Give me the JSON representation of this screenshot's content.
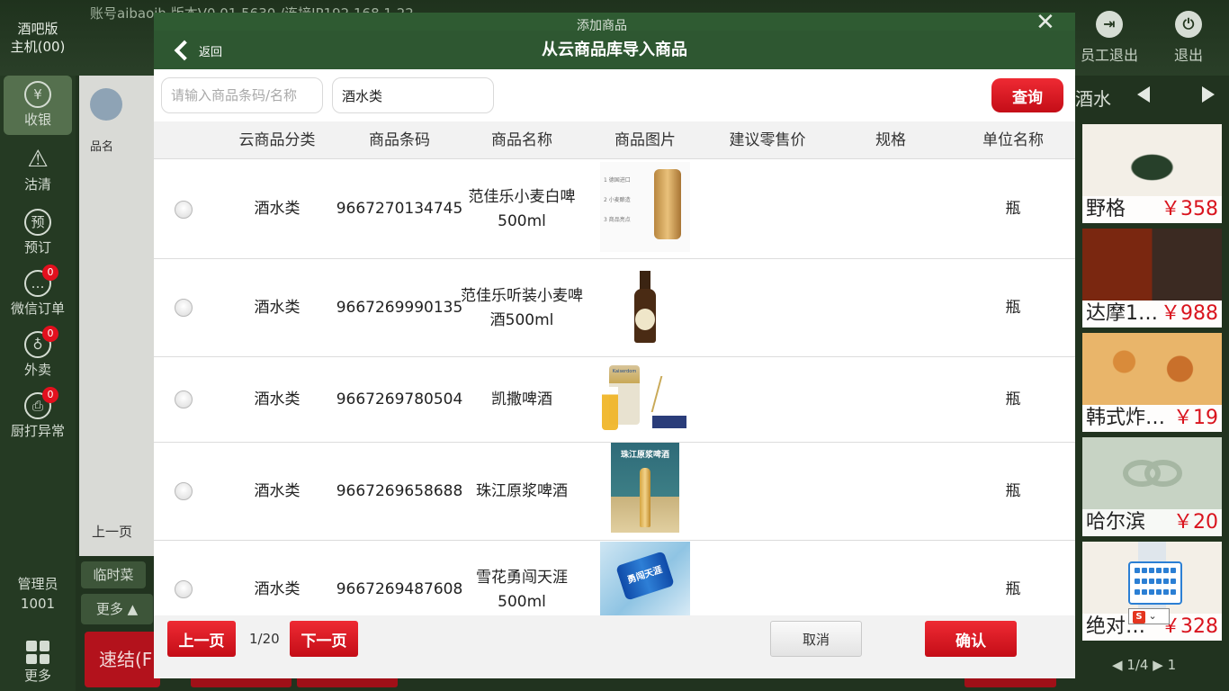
{
  "background": {
    "account_line": "账号aibaojh 版本V0.01.5630 /连接IP192.168.1.22",
    "brand_line1": "酒吧版",
    "brand_line2": "主机(00)",
    "sidebar": [
      {
        "label": "收银",
        "icon": "¥",
        "badge": null
      },
      {
        "label": "沽清",
        "icon": "⚠",
        "badge": null
      },
      {
        "label": "预订",
        "icon": "预",
        "badge": null
      },
      {
        "label": "微信订单",
        "icon": "…",
        "badge": "0"
      },
      {
        "label": "外卖",
        "icon": "♁",
        "badge": "0"
      },
      {
        "label": "厨打异常",
        "icon": "⎙",
        "badge": "0"
      }
    ],
    "user_role": "管理员",
    "user_id": "1001",
    "more_label": "更多",
    "order_name_header": "品名",
    "order_prev": "上一页",
    "temp_dish": "临时菜",
    "more_toggle": "更多",
    "quick_checkout": "速结(F",
    "staff_logout": "员工退出",
    "logout": "退出",
    "category_label": "酒水",
    "products": [
      {
        "name": "野格",
        "price": "￥358"
      },
      {
        "name": "达摩1…",
        "price": "￥988"
      },
      {
        "name": "韩式炸…",
        "price": "￥19"
      },
      {
        "name": "哈尔滨",
        "price": "￥20"
      },
      {
        "name": "绝对…",
        "price": "￥328"
      }
    ],
    "product_pager": "1/4",
    "product_pager_suffix": "1"
  },
  "modal": {
    "behind_title": "添加商品",
    "back_label": "返回",
    "title": "从云商品库导入商品",
    "search": {
      "placeholder": "请输入商品条码/名称",
      "category_value": "酒水类",
      "query_label": "查询"
    },
    "columns": [
      "云商品分类",
      "商品条码",
      "商品名称",
      "商品图片",
      "建议零售价",
      "规格",
      "单位名称"
    ],
    "rows": [
      {
        "category": "酒水类",
        "barcode": "9667270134745",
        "name": "范佳乐小麦白啤500ml",
        "price": "",
        "spec": "",
        "unit": "瓶"
      },
      {
        "category": "酒水类",
        "barcode": "9667269990135",
        "name": "范佳乐听装小麦啤酒500ml",
        "price": "",
        "spec": "",
        "unit": "瓶"
      },
      {
        "category": "酒水类",
        "barcode": "9667269780504",
        "name": "凯撒啤酒",
        "price": "",
        "spec": "",
        "unit": "瓶"
      },
      {
        "category": "酒水类",
        "barcode": "9667269658688",
        "name": "珠江原浆啤酒",
        "price": "",
        "spec": "",
        "unit": "瓶"
      },
      {
        "category": "酒水类",
        "barcode": "9667269487608",
        "name": "雪花勇闯天涯500ml",
        "price": "",
        "spec": "",
        "unit": "瓶"
      }
    ],
    "image_texts": {
      "img1_lines": [
        "1 德国进口",
        "2 小麦酿造",
        "3 商品亮点"
      ],
      "img4_title": "珠江原浆啤酒",
      "img5_text": "勇闯天涯",
      "img3_text": "Kaiserdom"
    },
    "footer": {
      "prev_label": "上一页",
      "page_indicator": "1/20",
      "next_label": "下一页",
      "cancel_label": "取消",
      "confirm_label": "确认"
    }
  },
  "keyboard": {
    "ime_glyph": "S"
  },
  "colors": {
    "header_green": "#2e5731",
    "accent_red": "#d9141e"
  }
}
